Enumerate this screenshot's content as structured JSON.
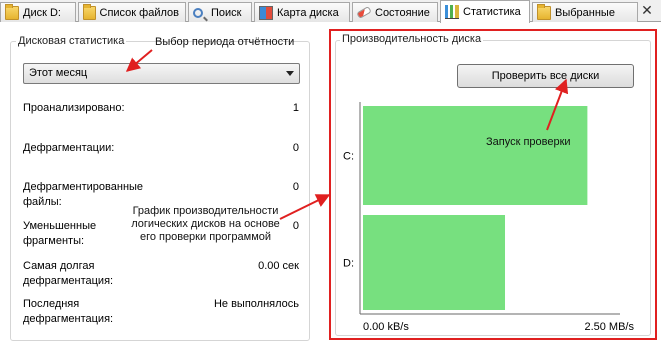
{
  "tabs": [
    {
      "label": "Диск D:",
      "icon": "disk-icon",
      "active": false
    },
    {
      "label": "Список файлов",
      "icon": "folder-icon",
      "active": false
    },
    {
      "label": "Поиск",
      "icon": "search-icon",
      "active": false
    },
    {
      "label": "Карта диска",
      "icon": "disk-map-icon",
      "active": false
    },
    {
      "label": "Состояние",
      "icon": "status-icon",
      "active": false
    },
    {
      "label": "Статистика",
      "icon": "statistics-icon",
      "active": true
    },
    {
      "label": "Выбранные",
      "icon": "folder-icon",
      "active": false
    }
  ],
  "close_glyph": "✕",
  "left_panel": {
    "title": "Дисковая статистика",
    "period_select": "Этот месяц",
    "stats": [
      {
        "label": "Проанализировано:",
        "value": "1"
      },
      {
        "label": "Дефрагментации:",
        "value": "0"
      },
      {
        "label": "Дефрагментированные файлы:",
        "value": "0"
      },
      {
        "label": "Уменьшенные фрагменты:",
        "value": "0"
      },
      {
        "label": "Самая долгая дефрагментация:",
        "value": "0.00 сек"
      },
      {
        "label": "Последняя дефрагментация:",
        "value": "Не выполнялось"
      }
    ]
  },
  "right_panel": {
    "title": "Производительность диска",
    "check_button": "Проверить все диски"
  },
  "annotations": {
    "period": "Выбор периода отчётности",
    "start_check": "Запуск проверки",
    "chart_note": "График производительности логических дисков на основе его проверки программой"
  },
  "accent_colors": {
    "bar": "#77e07f",
    "highlight": "#e02020"
  },
  "chart_data": {
    "type": "bar",
    "orientation": "horizontal",
    "categories": [
      "C:",
      "D:"
    ],
    "values": [
      2.07,
      1.31
    ],
    "units": "MB/s",
    "xlim": [
      0,
      2.5
    ],
    "tick_labels": [
      "0.00 kB/s",
      "2.50 MB/s"
    ]
  }
}
